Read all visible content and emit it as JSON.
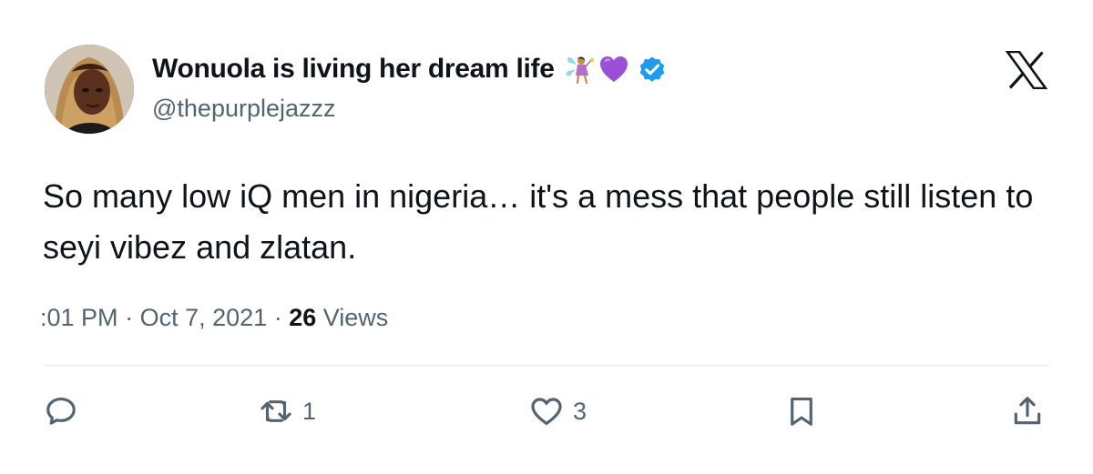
{
  "user": {
    "display_name": "Wonuola is living her dream life",
    "handle": "@thepurplejazzz",
    "emojis": [
      "fairy-emoji",
      "purple-heart-emoji"
    ],
    "verified": true,
    "verified_color": "#1d9bf0"
  },
  "tweet": {
    "text": "So many low iQ men in nigeria… it's a mess that people still listen to seyi vibez and zlatan.",
    "time": ":01 PM",
    "separator": "·",
    "date": "Oct 7, 2021",
    "views_count": "26",
    "views_label": "Views"
  },
  "actions": {
    "reply_count": "",
    "retweet_count": "1",
    "like_count": "3"
  },
  "icons": {
    "brand": "x-logo-icon",
    "reply": "reply-icon",
    "retweet": "retweet-icon",
    "like": "heart-icon",
    "bookmark": "bookmark-icon",
    "share": "share-icon"
  },
  "colors": {
    "text_primary": "#0f1419",
    "text_secondary": "#536471",
    "icon": "#536471",
    "divider": "#e6e9ec",
    "purple_heart": "#9b4fd6"
  }
}
